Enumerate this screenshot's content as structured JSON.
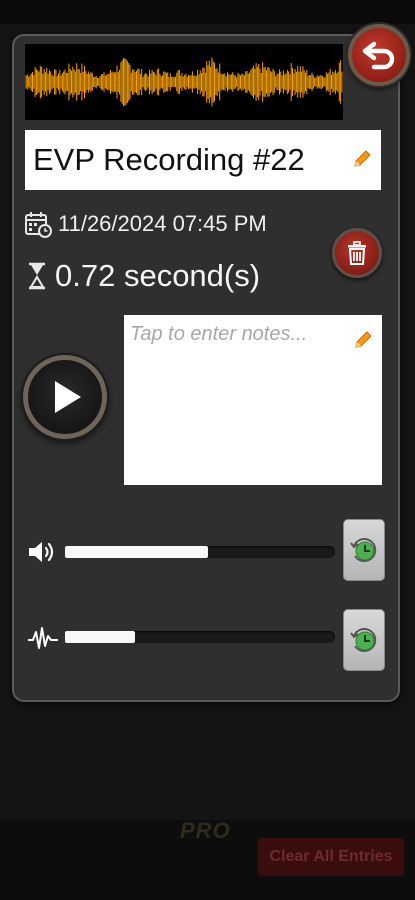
{
  "recording": {
    "title": "EVP Recording #22",
    "date": "11/26/2024 07:45 PM",
    "duration": "0.72 second(s)",
    "notes_placeholder": "Tap to enter notes..."
  },
  "sliders": {
    "volume_level": 0.53,
    "waveform_level": 0.26
  },
  "background": {
    "pro_label": "PRO",
    "clear_all_label": "Clear All Entries"
  },
  "icons": {
    "back": "undo-arrow-icon",
    "edit": "pencil-icon",
    "calendar": "calendar-clock-icon",
    "duration": "hourglass-icon",
    "delete": "trash-icon",
    "play": "play-icon",
    "volume": "speaker-icon",
    "waveform": "pulse-wave-icon",
    "reset": "clock-reset-icon"
  },
  "colors": {
    "waveform": "#f5a000",
    "delete_button": "#a8281e",
    "back_button": "#b33326",
    "reset_clock": "#4caf50"
  }
}
